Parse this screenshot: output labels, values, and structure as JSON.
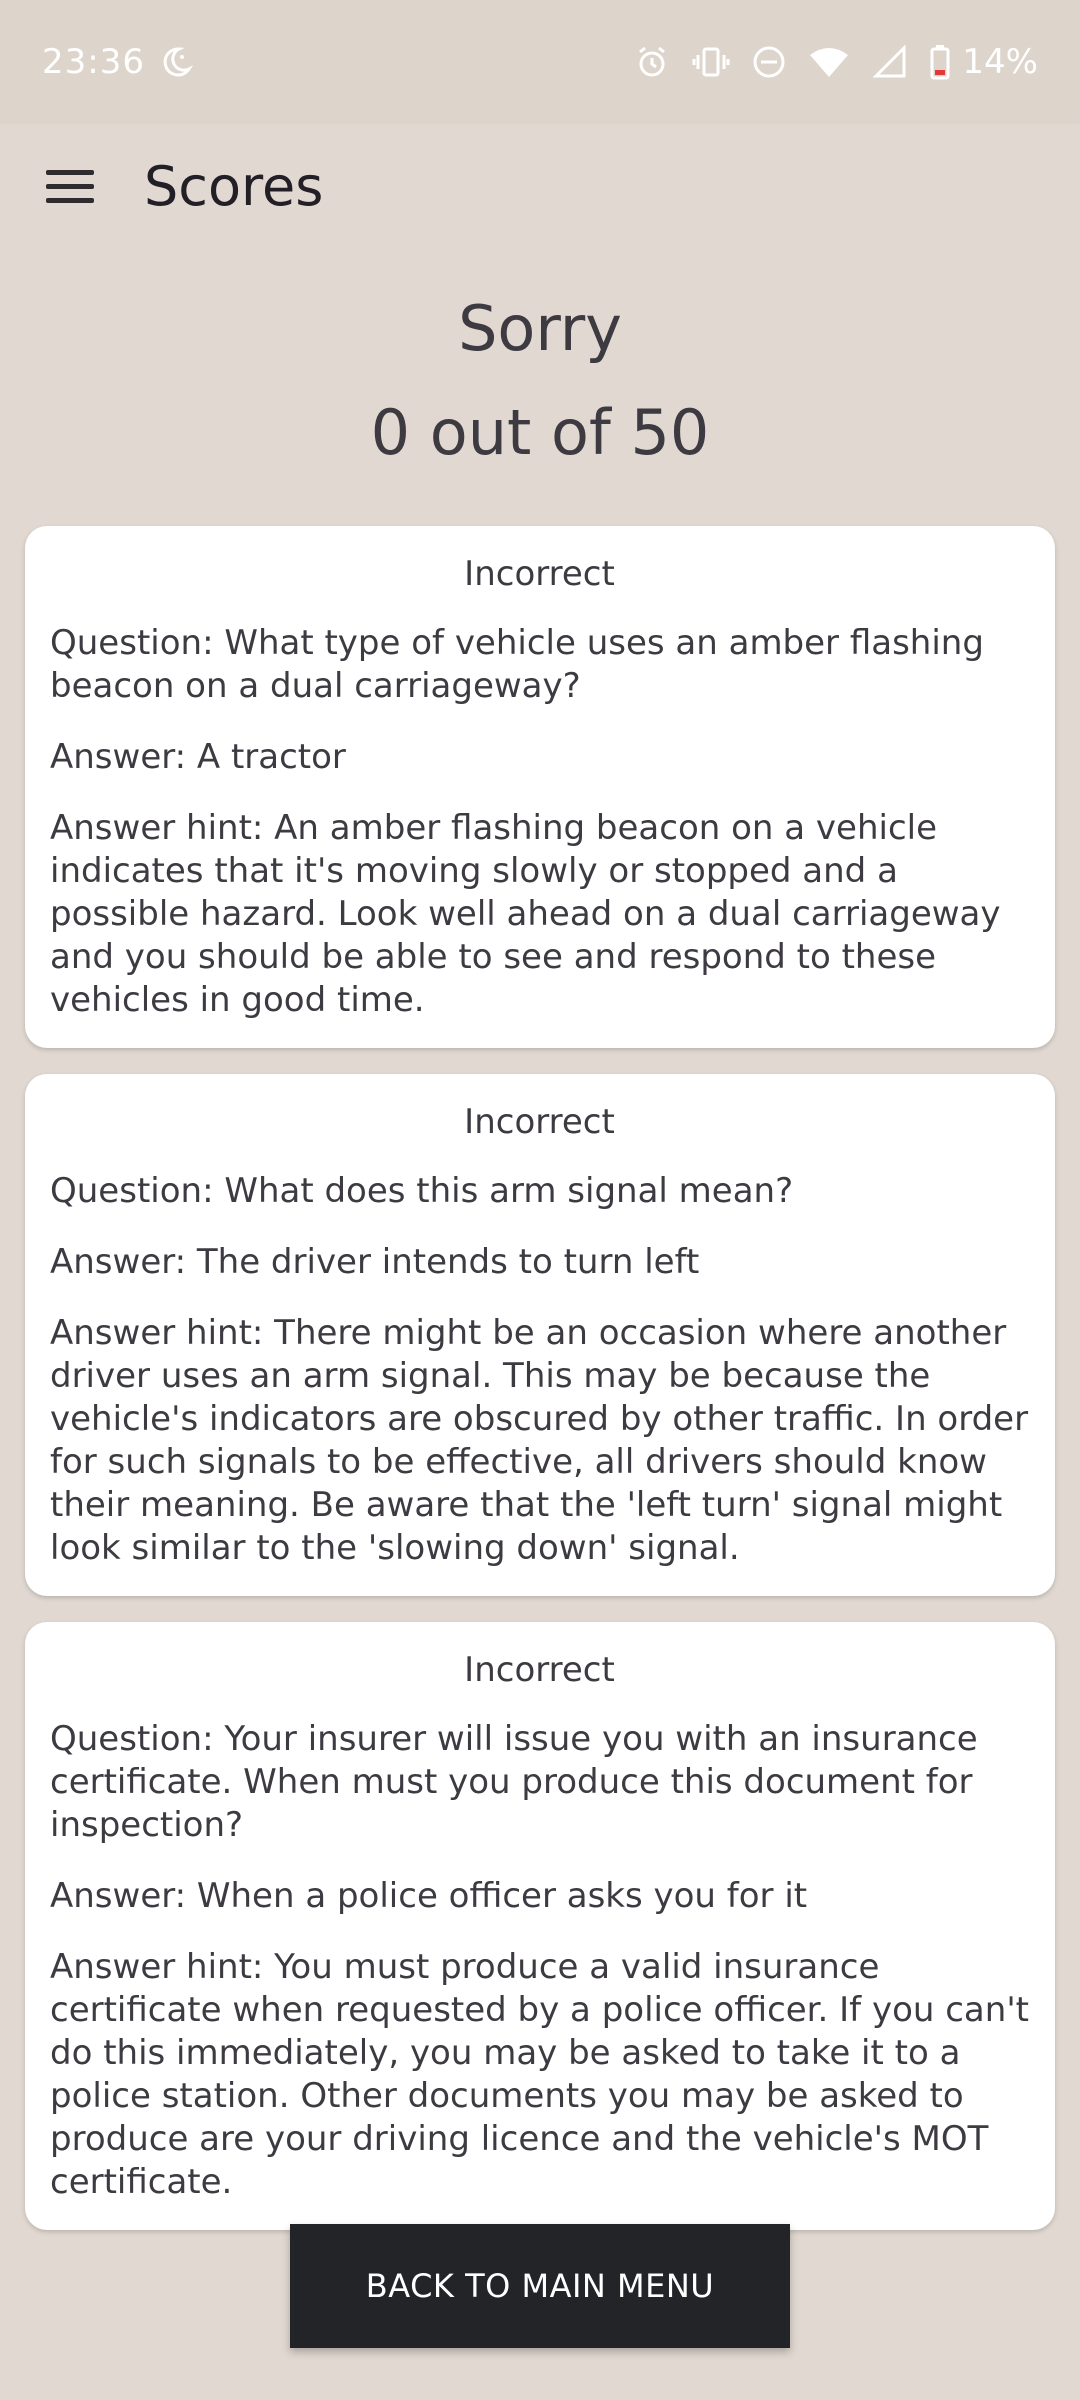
{
  "status_bar": {
    "time": "23:36",
    "battery": "14%",
    "icons": [
      "moon-icon",
      "alarm-icon",
      "vibrate-icon",
      "do-not-disturb-icon",
      "wifi-icon",
      "signal-icon",
      "battery-icon"
    ]
  },
  "app_bar": {
    "title": "Scores",
    "menu_icon": "menu-icon"
  },
  "result": {
    "title": "Sorry",
    "score": "0 out of 50"
  },
  "cards": [
    {
      "status": "Incorrect",
      "question": "Question: What type of vehicle uses an amber flashing beacon on a dual carriageway?",
      "answer": "Answer: A tractor",
      "hint": "Answer hint: An amber flashing beacon on a vehicle indicates that it's moving slowly or stopped and a possible hazard. Look well ahead on a dual carriageway and you should be able to see and respond to these vehicles in good time."
    },
    {
      "status": "Incorrect",
      "question": "Question: What does this arm signal mean?",
      "answer": "Answer: The driver intends to turn left",
      "hint": "Answer hint: There might be an occasion where another driver uses an arm signal. This may be because the vehicle's indicators are obscured by other traffic. In order for such signals to be effective, all drivers should know their meaning. Be aware that the 'left turn' signal might look similar to the 'slowing down' signal."
    },
    {
      "status": "Incorrect",
      "question": "Question: Your insurer will issue you with an insurance certificate. When must you produce this document for inspection?",
      "answer": "Answer: When a police officer asks you for it",
      "hint": "Answer hint: You must produce a valid insurance certificate when requested by a police officer. If you can't do this immediately, you may be asked to take it to a police station. Other documents you may be asked to produce are your driving licence and the vehicle's MOT certificate."
    }
  ],
  "button": {
    "label": "BACK TO MAIN MENU"
  },
  "colors": {
    "background": "#e1d9d1",
    "card": "#ffffff",
    "button": "#232428",
    "text": "#3d3a42"
  }
}
